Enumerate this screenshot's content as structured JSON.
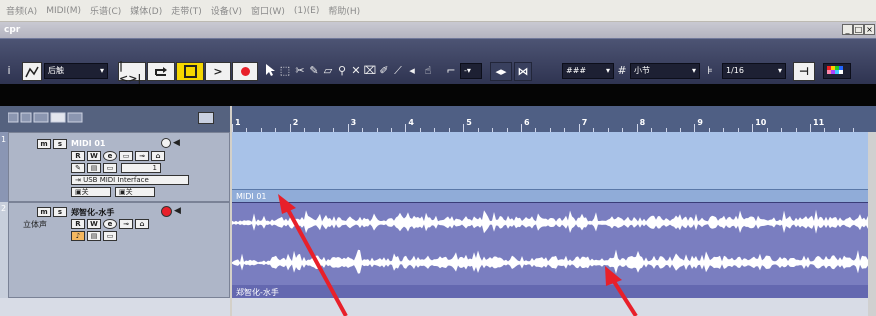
{
  "menubar": {
    "items": [
      "音频(A)",
      "MIDI(M)",
      "乐谱(C)",
      "媒体(D)",
      "走带(T)",
      "设备(V)",
      "窗口(W)",
      "(1)(E)",
      "帮助(H)"
    ]
  },
  "titlebar": {
    "title": "cpr",
    "minimize": "_",
    "restore": "□",
    "close": "×"
  },
  "toolbar": {
    "automation_mode": "后触",
    "grid_type": "小节",
    "quantize": "1/16",
    "snap_symbol": "###"
  },
  "ruler": {
    "bars": [
      "1",
      "2",
      "3",
      "4",
      "5",
      "6",
      "7",
      "8",
      "9",
      "10",
      "11"
    ]
  },
  "tracks": [
    {
      "number": "1",
      "name": "MIDI 01",
      "mute": "m",
      "solo": "s",
      "channel": "1",
      "output": "USB MIDI Interface",
      "insert_a": "关",
      "insert_b": "关",
      "part_label": "MIDI 01"
    },
    {
      "number": "2",
      "name": "郑智化-水手",
      "mute": "m",
      "solo": "s",
      "type": "立体声",
      "part_label": "郑智化-水手"
    }
  ],
  "colors": {
    "toolbar_bg": "#3d4462",
    "midi_part": "#a8c2e8",
    "audio_part": "#7a7ec0",
    "annotation_arrow": "#e8202a",
    "record_button": "#e8202a",
    "play_button": "#ffffff",
    "cycle_button_bg": "#f5d700"
  }
}
